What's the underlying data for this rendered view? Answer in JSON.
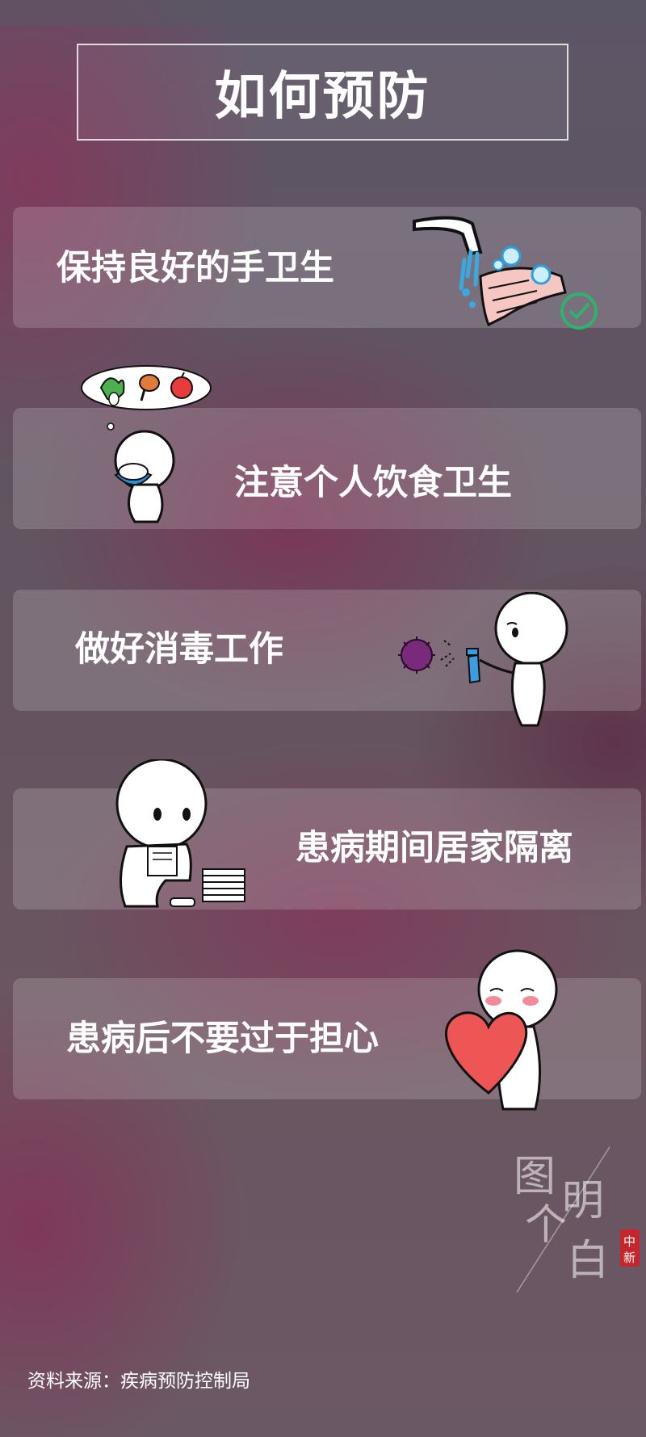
{
  "title": "如何预防",
  "tips": [
    {
      "label": "保持良好的手卫生",
      "icon": "hand-washing-icon"
    },
    {
      "label": "注意个人饮食卫生",
      "icon": "eating-icon"
    },
    {
      "label": "做好消毒工作",
      "icon": "disinfection-spray-icon"
    },
    {
      "label": "患病期间居家隔离",
      "icon": "home-isolation-icon"
    },
    {
      "label": "患病后不要过于担心",
      "icon": "heart-icon"
    }
  ],
  "source": "资料来源：疾病预防控制局",
  "watermark": {
    "text": "图个明白",
    "badge": "中新"
  },
  "colors": {
    "background": "#625460",
    "accent_red": "#e84c4c",
    "check_green": "#2db36b"
  }
}
